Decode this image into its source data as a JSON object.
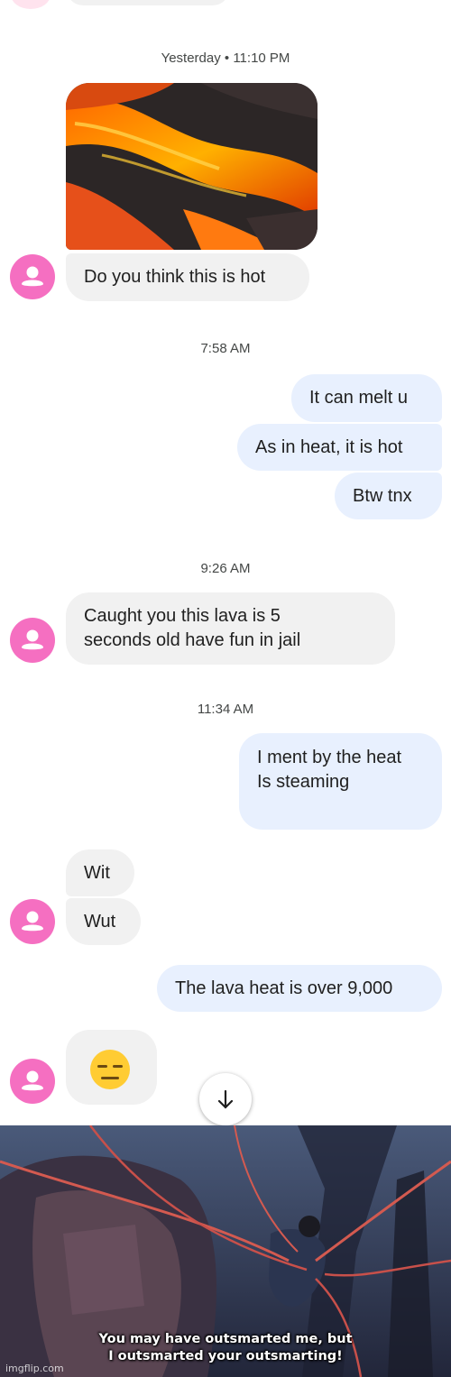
{
  "conversation": {
    "timestamps": [
      "Yesterday • 11:10 PM",
      "7:58 AM",
      "9:26 AM",
      "11:34 AM"
    ],
    "messages": [
      {
        "from": "them",
        "text": "Do you think this is hot"
      },
      {
        "from": "me",
        "text": "It can melt u"
      },
      {
        "from": "me",
        "text": "As in heat, it is hot"
      },
      {
        "from": "me",
        "text": "Btw tnx"
      },
      {
        "from": "them",
        "text": "Caught you this lava is 5\nseconds old have fun in jail"
      },
      {
        "from": "me",
        "text": "I ment by the heat\nIs steaming"
      },
      {
        "from": "them",
        "text": "Wit"
      },
      {
        "from": "them",
        "text": "Wut"
      },
      {
        "from": "me",
        "text": "The lava heat is over 9,000"
      },
      {
        "from": "them",
        "text": "😑",
        "emoji": "expressionless-face"
      }
    ],
    "image_attachment": "lava-flow-photo",
    "scroll_button_icon": "arrow-down-icon"
  },
  "meme": {
    "caption_line1": "You may have outsmarted me, but",
    "caption_line2": "I outsmarted your outsmarting!",
    "watermark": "imgflip.com"
  },
  "colors": {
    "incoming_bubble": "#f1f1f1",
    "outgoing_bubble": "#e8f0fe",
    "avatar": "#f56fc1"
  }
}
